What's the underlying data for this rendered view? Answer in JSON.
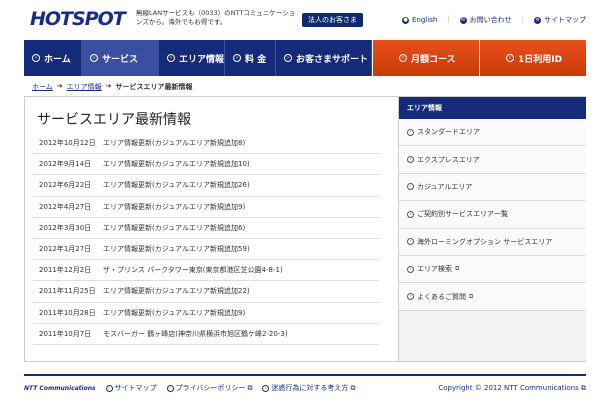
{
  "header": {
    "logo": "HOTSPOT",
    "tagline": "無線LANサービスも（0033）のNTTコミュニケーションズから。海外でもお得です。",
    "corp_button": "法人のお客さま",
    "links": [
      {
        "label": "English",
        "icon": "globe-icon"
      },
      {
        "label": "お問い合わせ",
        "icon": "mail-icon"
      },
      {
        "label": "サイトマップ",
        "icon": "sitemap-icon"
      }
    ]
  },
  "nav": {
    "items": [
      {
        "label": "ホーム",
        "active": false
      },
      {
        "label": "サービス",
        "active": true
      },
      {
        "label": "エリア情報",
        "active": false
      },
      {
        "label": "料 金",
        "active": false
      },
      {
        "label": "お客さまサポート",
        "active": false
      }
    ],
    "orange": [
      {
        "label": "月額コース"
      },
      {
        "label": "1日利用ID"
      }
    ]
  },
  "breadcrumb": {
    "items": [
      "ホーム",
      "エリア情報",
      "サービスエリア最新情報"
    ]
  },
  "main": {
    "title": "サービスエリア最新情報",
    "news": [
      {
        "date": "2012年10月12日",
        "text": "エリア情報更新(カジュアルエリア新規追加8)"
      },
      {
        "date": "2012年9月14日",
        "text": "エリア情報更新(カジュアルエリア新規追加10)"
      },
      {
        "date": "2012年6月22日",
        "text": "エリア情報更新(カジュアルエリア新規追加26)"
      },
      {
        "date": "2012年4月27日",
        "text": "エリア情報更新(カジュアルエリア新規追加9)"
      },
      {
        "date": "2012年3月30日",
        "text": "エリア情報更新(カジュアルエリア新規追加6)"
      },
      {
        "date": "2012年1月27日",
        "text": "エリア情報更新(カジュアルエリア新規追加59)"
      },
      {
        "date": "2011年12月2日",
        "text": "ザ・プリンス パークタワー東京(東京都港区芝公園4-8-1)"
      },
      {
        "date": "2011年11月25日",
        "text": "エリア情報更新(カジュアルエリア新規追加22)"
      },
      {
        "date": "2011年10月28日",
        "text": "エリア情報更新(カジュアルエリア新規追加9)"
      },
      {
        "date": "2011年10月7日",
        "text": "モスバーガー 鶴ヶ峰店(神奈川県横浜市旭区鶴ケ峰2-20-3)"
      }
    ]
  },
  "sidebar": {
    "heading": "エリア情報",
    "items": [
      {
        "label": "スタンダードエリア",
        "ext": false
      },
      {
        "label": "エクスプレスエリア",
        "ext": false
      },
      {
        "label": "カジュアルエリア",
        "ext": false
      },
      {
        "label": "ご契約別サービスエリア一覧",
        "ext": false
      },
      {
        "label": "海外ローミングオプション サービスエリア",
        "ext": false
      },
      {
        "label": "エリア検索",
        "ext": true
      },
      {
        "label": "よくあるご質問",
        "ext": true
      }
    ]
  },
  "footer": {
    "logo": "NTT Communications",
    "links": [
      {
        "label": "サイトマップ",
        "ext": false
      },
      {
        "label": "プライバシーポリシー",
        "ext": true
      },
      {
        "label": "迷惑行為に対する考え方",
        "ext": true
      }
    ],
    "copyright": "Copyright © 2012 NTT Communications"
  }
}
